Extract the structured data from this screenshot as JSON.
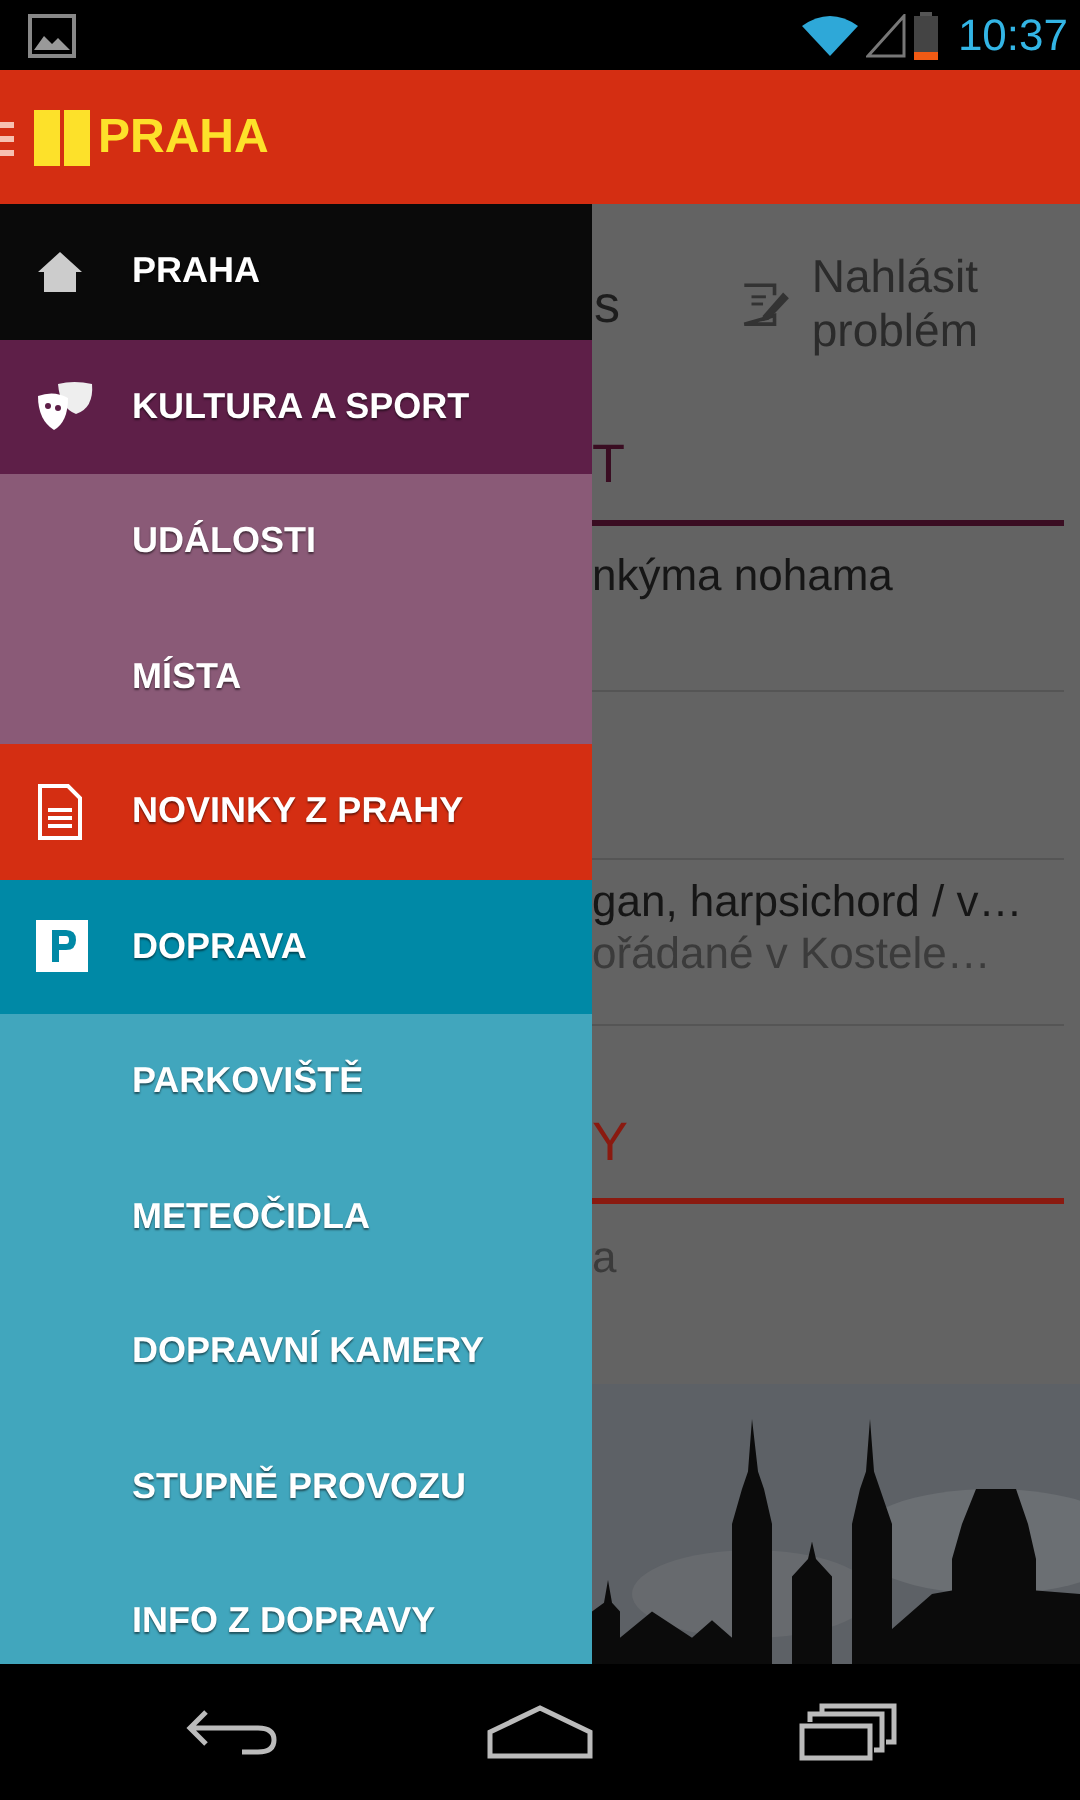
{
  "status_bar": {
    "time": "10:37"
  },
  "app_bar": {
    "title": "PRAHA"
  },
  "drawer": {
    "items": [
      {
        "label": "PRAHA",
        "kind": "header",
        "color": "#0a0a0a"
      },
      {
        "label": "KULTURA A SPORT",
        "kind": "header",
        "color": "#5e1f48"
      },
      {
        "label": "UDÁLOSTI",
        "kind": "sub",
        "color": "#8a5a77"
      },
      {
        "label": "MÍSTA",
        "kind": "sub",
        "color": "#8a5a77"
      },
      {
        "label": "NOVINKY Z PRAHY",
        "kind": "header",
        "color": "#d42e12"
      },
      {
        "label": "DOPRAVA",
        "kind": "header",
        "color": "#0089a6"
      },
      {
        "label": "PARKOVIŠTĚ",
        "kind": "sub",
        "color": "#41a6bd"
      },
      {
        "label": "METEOČIDLA",
        "kind": "sub",
        "color": "#41a6bd"
      },
      {
        "label": "DOPRAVNÍ KAMERY",
        "kind": "sub",
        "color": "#41a6bd"
      },
      {
        "label": "STUPNĚ PROVOZU",
        "kind": "sub",
        "color": "#41a6bd"
      },
      {
        "label": "INFO Z DOPRAVY",
        "kind": "sub",
        "color": "#41a6bd"
      }
    ]
  },
  "content": {
    "tab_fragment": "s",
    "report_button": "Nahlásit problém",
    "sections": [
      {
        "heading": "T",
        "color": "#3a0d22",
        "rows": [
          {
            "title": "nkýma nohama"
          },
          {
            "title": "gan, harpsichord / v…",
            "subtitle": "ořádané v Kostele…"
          }
        ]
      },
      {
        "heading": "Y",
        "color": "#8a1a10",
        "rows": [
          {
            "subtitle": "a"
          }
        ]
      }
    ]
  }
}
